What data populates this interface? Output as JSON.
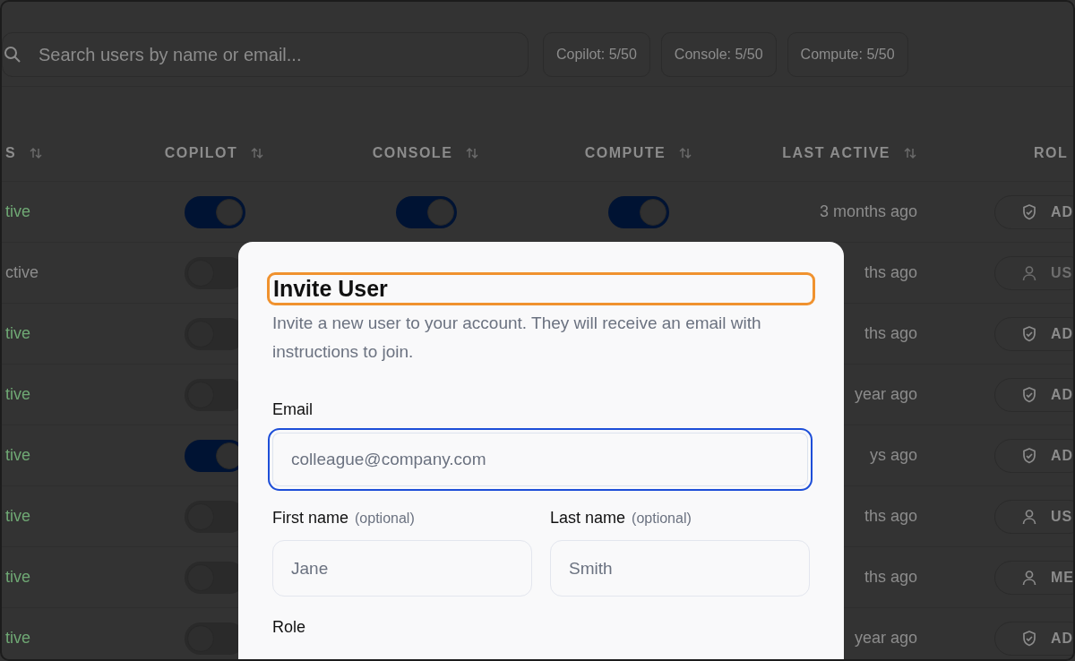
{
  "search": {
    "placeholder": "Search users by name or email..."
  },
  "usage_chips": [
    "Copilot: 5/50",
    "Console: 5/50",
    "Compute: 5/50"
  ],
  "table": {
    "columns": [
      "S",
      "COPILOT",
      "CONSOLE",
      "COMPUTE",
      "LAST ACTIVE",
      "ROL"
    ],
    "rows": [
      {
        "status": "tive",
        "active": true,
        "copilot": {
          "on": true
        },
        "console": {
          "on": true
        },
        "compute": {
          "on": true
        },
        "last_active": "3 months ago",
        "role": {
          "kind": "admin",
          "label": "AD",
          "disabled": false
        }
      },
      {
        "status": "ctive",
        "active": false,
        "copilot": {
          "on": false
        },
        "last_active": "ths ago",
        "role": {
          "kind": "user",
          "label": "US",
          "disabled": true
        }
      },
      {
        "status": "tive",
        "active": true,
        "copilot": {
          "on": false
        },
        "last_active": "ths ago",
        "role": {
          "kind": "admin",
          "label": "AD",
          "disabled": false
        }
      },
      {
        "status": "tive",
        "active": true,
        "copilot": {
          "on": false
        },
        "last_active": "year ago",
        "role": {
          "kind": "admin",
          "label": "AD",
          "disabled": false
        }
      },
      {
        "status": "tive",
        "active": true,
        "copilot": {
          "on": true
        },
        "last_active": "ys ago",
        "role": {
          "kind": "admin",
          "label": "AD",
          "disabled": false
        }
      },
      {
        "status": "tive",
        "active": true,
        "copilot": {
          "on": false
        },
        "last_active": "ths ago",
        "role": {
          "kind": "user",
          "label": "US",
          "disabled": false
        }
      },
      {
        "status": "tive",
        "active": true,
        "copilot": {
          "on": false
        },
        "last_active": "ths ago",
        "role": {
          "kind": "user",
          "label": "ME",
          "disabled": false
        }
      },
      {
        "status": "tive",
        "active": true,
        "copilot": {
          "on": false
        },
        "last_active": "year ago",
        "role": {
          "kind": "admin",
          "label": "AD",
          "disabled": false
        }
      }
    ]
  },
  "dialog": {
    "title": "Invite User",
    "title_highlighted": true,
    "description": "Invite a new user to your account. They will receive an email with instructions to join.",
    "email": {
      "label": "Email",
      "placeholder": "colleague@company.com",
      "focused": true
    },
    "first_name": {
      "label": "First name",
      "hint": "(optional)",
      "placeholder": "Jane"
    },
    "last_name": {
      "label": "Last name",
      "hint": "(optional)",
      "placeholder": "Smith"
    },
    "role_label": "Role"
  }
}
